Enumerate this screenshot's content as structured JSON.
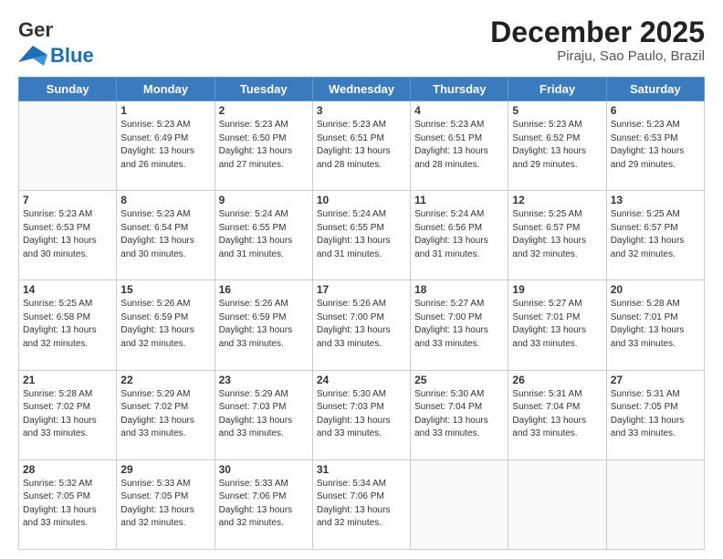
{
  "header": {
    "logo_general": "General",
    "logo_blue": "Blue",
    "month_title": "December 2025",
    "location": "Piraju, Sao Paulo, Brazil"
  },
  "days_of_week": [
    "Sunday",
    "Monday",
    "Tuesday",
    "Wednesday",
    "Thursday",
    "Friday",
    "Saturday"
  ],
  "weeks": [
    [
      {
        "day": "",
        "info": ""
      },
      {
        "day": "1",
        "info": "Sunrise: 5:23 AM\nSunset: 6:49 PM\nDaylight: 13 hours\nand 26 minutes."
      },
      {
        "day": "2",
        "info": "Sunrise: 5:23 AM\nSunset: 6:50 PM\nDaylight: 13 hours\nand 27 minutes."
      },
      {
        "day": "3",
        "info": "Sunrise: 5:23 AM\nSunset: 6:51 PM\nDaylight: 13 hours\nand 28 minutes."
      },
      {
        "day": "4",
        "info": "Sunrise: 5:23 AM\nSunset: 6:51 PM\nDaylight: 13 hours\nand 28 minutes."
      },
      {
        "day": "5",
        "info": "Sunrise: 5:23 AM\nSunset: 6:52 PM\nDaylight: 13 hours\nand 29 minutes."
      },
      {
        "day": "6",
        "info": "Sunrise: 5:23 AM\nSunset: 6:53 PM\nDaylight: 13 hours\nand 29 minutes."
      }
    ],
    [
      {
        "day": "7",
        "info": "Sunrise: 5:23 AM\nSunset: 6:53 PM\nDaylight: 13 hours\nand 30 minutes."
      },
      {
        "day": "8",
        "info": "Sunrise: 5:23 AM\nSunset: 6:54 PM\nDaylight: 13 hours\nand 30 minutes."
      },
      {
        "day": "9",
        "info": "Sunrise: 5:24 AM\nSunset: 6:55 PM\nDaylight: 13 hours\nand 31 minutes."
      },
      {
        "day": "10",
        "info": "Sunrise: 5:24 AM\nSunset: 6:55 PM\nDaylight: 13 hours\nand 31 minutes."
      },
      {
        "day": "11",
        "info": "Sunrise: 5:24 AM\nSunset: 6:56 PM\nDaylight: 13 hours\nand 31 minutes."
      },
      {
        "day": "12",
        "info": "Sunrise: 5:25 AM\nSunset: 6:57 PM\nDaylight: 13 hours\nand 32 minutes."
      },
      {
        "day": "13",
        "info": "Sunrise: 5:25 AM\nSunset: 6:57 PM\nDaylight: 13 hours\nand 32 minutes."
      }
    ],
    [
      {
        "day": "14",
        "info": "Sunrise: 5:25 AM\nSunset: 6:58 PM\nDaylight: 13 hours\nand 32 minutes."
      },
      {
        "day": "15",
        "info": "Sunrise: 5:26 AM\nSunset: 6:59 PM\nDaylight: 13 hours\nand 32 minutes."
      },
      {
        "day": "16",
        "info": "Sunrise: 5:26 AM\nSunset: 6:59 PM\nDaylight: 13 hours\nand 33 minutes."
      },
      {
        "day": "17",
        "info": "Sunrise: 5:26 AM\nSunset: 7:00 PM\nDaylight: 13 hours\nand 33 minutes."
      },
      {
        "day": "18",
        "info": "Sunrise: 5:27 AM\nSunset: 7:00 PM\nDaylight: 13 hours\nand 33 minutes."
      },
      {
        "day": "19",
        "info": "Sunrise: 5:27 AM\nSunset: 7:01 PM\nDaylight: 13 hours\nand 33 minutes."
      },
      {
        "day": "20",
        "info": "Sunrise: 5:28 AM\nSunset: 7:01 PM\nDaylight: 13 hours\nand 33 minutes."
      }
    ],
    [
      {
        "day": "21",
        "info": "Sunrise: 5:28 AM\nSunset: 7:02 PM\nDaylight: 13 hours\nand 33 minutes."
      },
      {
        "day": "22",
        "info": "Sunrise: 5:29 AM\nSunset: 7:02 PM\nDaylight: 13 hours\nand 33 minutes."
      },
      {
        "day": "23",
        "info": "Sunrise: 5:29 AM\nSunset: 7:03 PM\nDaylight: 13 hours\nand 33 minutes."
      },
      {
        "day": "24",
        "info": "Sunrise: 5:30 AM\nSunset: 7:03 PM\nDaylight: 13 hours\nand 33 minutes."
      },
      {
        "day": "25",
        "info": "Sunrise: 5:30 AM\nSunset: 7:04 PM\nDaylight: 13 hours\nand 33 minutes."
      },
      {
        "day": "26",
        "info": "Sunrise: 5:31 AM\nSunset: 7:04 PM\nDaylight: 13 hours\nand 33 minutes."
      },
      {
        "day": "27",
        "info": "Sunrise: 5:31 AM\nSunset: 7:05 PM\nDaylight: 13 hours\nand 33 minutes."
      }
    ],
    [
      {
        "day": "28",
        "info": "Sunrise: 5:32 AM\nSunset: 7:05 PM\nDaylight: 13 hours\nand 33 minutes."
      },
      {
        "day": "29",
        "info": "Sunrise: 5:33 AM\nSunset: 7:05 PM\nDaylight: 13 hours\nand 32 minutes."
      },
      {
        "day": "30",
        "info": "Sunrise: 5:33 AM\nSunset: 7:06 PM\nDaylight: 13 hours\nand 32 minutes."
      },
      {
        "day": "31",
        "info": "Sunrise: 5:34 AM\nSunset: 7:06 PM\nDaylight: 13 hours\nand 32 minutes."
      },
      {
        "day": "",
        "info": ""
      },
      {
        "day": "",
        "info": ""
      },
      {
        "day": "",
        "info": ""
      }
    ]
  ]
}
